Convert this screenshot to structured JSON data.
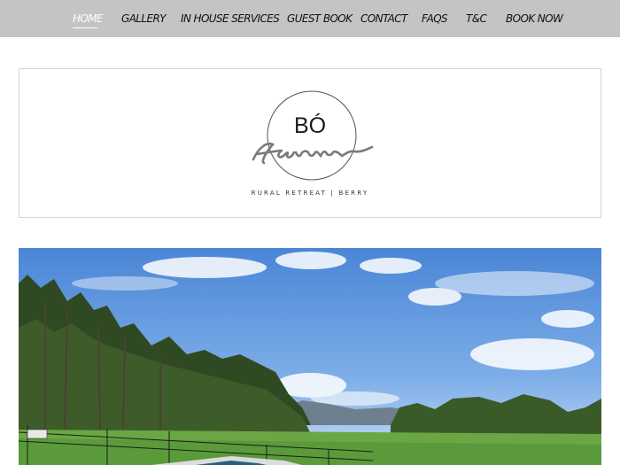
{
  "nav": {
    "items": [
      {
        "label": "HOME",
        "active": true
      },
      {
        "label": "GALLERY"
      },
      {
        "label": "IN HOUSE SERVICES"
      },
      {
        "label": "GUEST BOOK"
      },
      {
        "label": "CONTACT"
      },
      {
        "label": "FAQS"
      },
      {
        "label": "T&C"
      },
      {
        "label": "BOOK NOW"
      }
    ],
    "background_color": "#c4c4c4"
  },
  "logo": {
    "brand": "BÓ",
    "script_word": "farm",
    "tagline": "RURAL RETREAT  |  BERRY"
  },
  "hero": {
    "scene": "landscape-photo"
  }
}
